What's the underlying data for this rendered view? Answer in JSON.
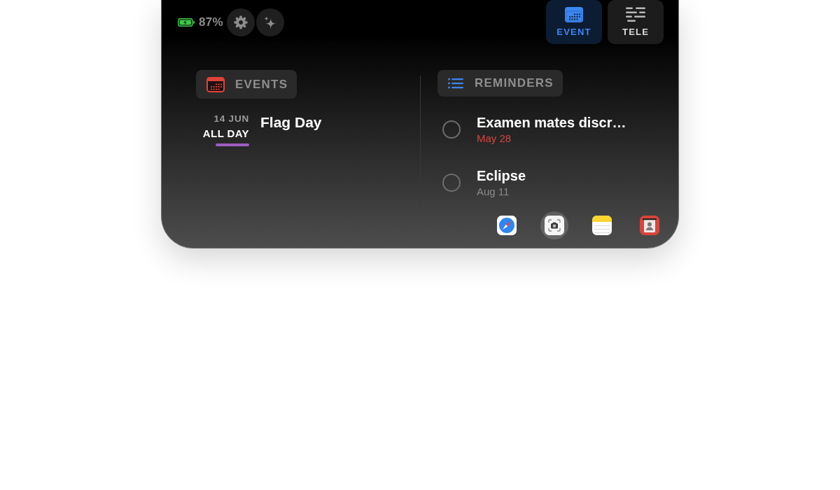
{
  "status": {
    "battery_charging": true,
    "battery_percent": "87%"
  },
  "tabs": [
    {
      "label": "EVENT",
      "kind": "calendar",
      "selected": true
    },
    {
      "label": "TELE",
      "kind": "lines",
      "selected": false
    }
  ],
  "events": {
    "title": "EVENTS",
    "items": [
      {
        "date": "14 JUN",
        "time": "ALL DAY",
        "title": "Flag Day",
        "color": "#a05cc0"
      }
    ]
  },
  "reminders": {
    "title": "REMINDERS",
    "items": [
      {
        "title": "Examen mates discr…",
        "date": "May 28",
        "overdue": true,
        "completed": false
      },
      {
        "title": "Eclipse",
        "date": "Aug 11",
        "overdue": false,
        "completed": false
      }
    ]
  },
  "apps": [
    {
      "kind": "compass",
      "highlighted": false
    },
    {
      "kind": "camera",
      "highlighted": true
    },
    {
      "kind": "notes",
      "highlighted": false
    },
    {
      "kind": "badge",
      "highlighted": false
    }
  ]
}
